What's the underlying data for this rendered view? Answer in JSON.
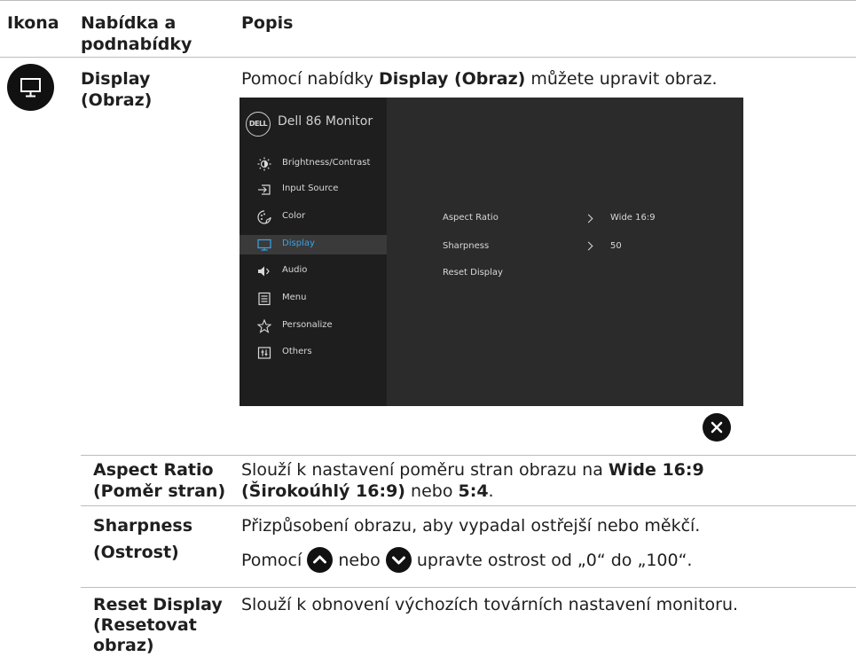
{
  "header": {
    "col_icon": "Ikona",
    "col_menu_line1": "Nabídka a",
    "col_menu_line2": "podnabídky",
    "col_desc": "Popis"
  },
  "display_row": {
    "menu_line1": "Display",
    "menu_line2": "(Obraz)",
    "desc_pre": "Pomocí nabídky ",
    "desc_bold": "Display (Obraz)",
    "desc_post": " můžete upravit obraz."
  },
  "osd": {
    "logo": "DELL",
    "title": "Dell 86 Monitor",
    "menu_items": [
      {
        "label": "Brightness/Contrast",
        "icon": "brightness-icon"
      },
      {
        "label": "Input Source",
        "icon": "input-source-icon"
      },
      {
        "label": "Color",
        "icon": "color-icon"
      },
      {
        "label": "Display",
        "icon": "display-icon"
      },
      {
        "label": "Audio",
        "icon": "audio-icon"
      },
      {
        "label": "Menu",
        "icon": "menu-icon"
      },
      {
        "label": "Personalize",
        "icon": "star-icon"
      },
      {
        "label": "Others",
        "icon": "others-icon"
      }
    ],
    "active_item": "Display",
    "options": [
      {
        "label": "Aspect Ratio",
        "value": "Wide 16:9"
      },
      {
        "label": "Sharpness",
        "value": "50"
      },
      {
        "label": "Reset Display",
        "value": ""
      }
    ],
    "accent_color": "#38a3e8"
  },
  "close_icon": "close-icon",
  "rows": {
    "aspect": {
      "name_line1": "Aspect Ratio",
      "name_line2": "(Poměr stran)",
      "desc_line1_pre": "Slouží k nastavení poměru stran obrazu na ",
      "desc_line1_bold": "Wide 16:9",
      "desc_line2_bold1": "(Širokoúhlý 16:9)",
      "desc_line2_mid": " nebo ",
      "desc_line2_bold2": "5:4",
      "desc_line2_end": "."
    },
    "sharpness": {
      "name_line1": "Sharpness",
      "name_line2": "(Ostrost)",
      "desc_line1": "Přizpůsobení obrazu, aby vypadal ostřejší nebo měkčí.",
      "desc_line2_pre": "Pomocí ",
      "desc_line2_mid": " nebo ",
      "desc_line2_post": " upravte ostrost od „0“ do „100“."
    },
    "reset": {
      "name_line1": "Reset Display",
      "name_line2": "(Resetovat",
      "name_line3": "obraz)",
      "desc": "Slouží k obnovení výchozích továrních nastavení monitoru."
    }
  }
}
